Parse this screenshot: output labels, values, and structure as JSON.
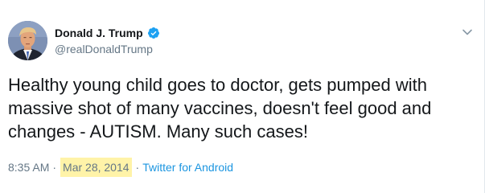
{
  "tweet": {
    "author": {
      "name": "Donald J. Trump",
      "handle": "@realDonaldTrump",
      "verified": true,
      "avatar_icon": "avatar-portrait"
    },
    "text": "Healthy young child goes to doctor, gets pumped with massive shot of many vaccines, doesn't feel good and changes - AUTISM. Many such cases!",
    "time": "8:35 AM",
    "separator": "·",
    "date": "Mar 28, 2014",
    "source": "Twitter for Android",
    "menu_icon": "chevron-down-icon"
  },
  "colors": {
    "verified_blue": "#1da1f2",
    "link_blue": "#1b95e0",
    "meta_gray": "#657786",
    "text_dark": "#14171a",
    "date_highlight": "#fff3a8"
  }
}
